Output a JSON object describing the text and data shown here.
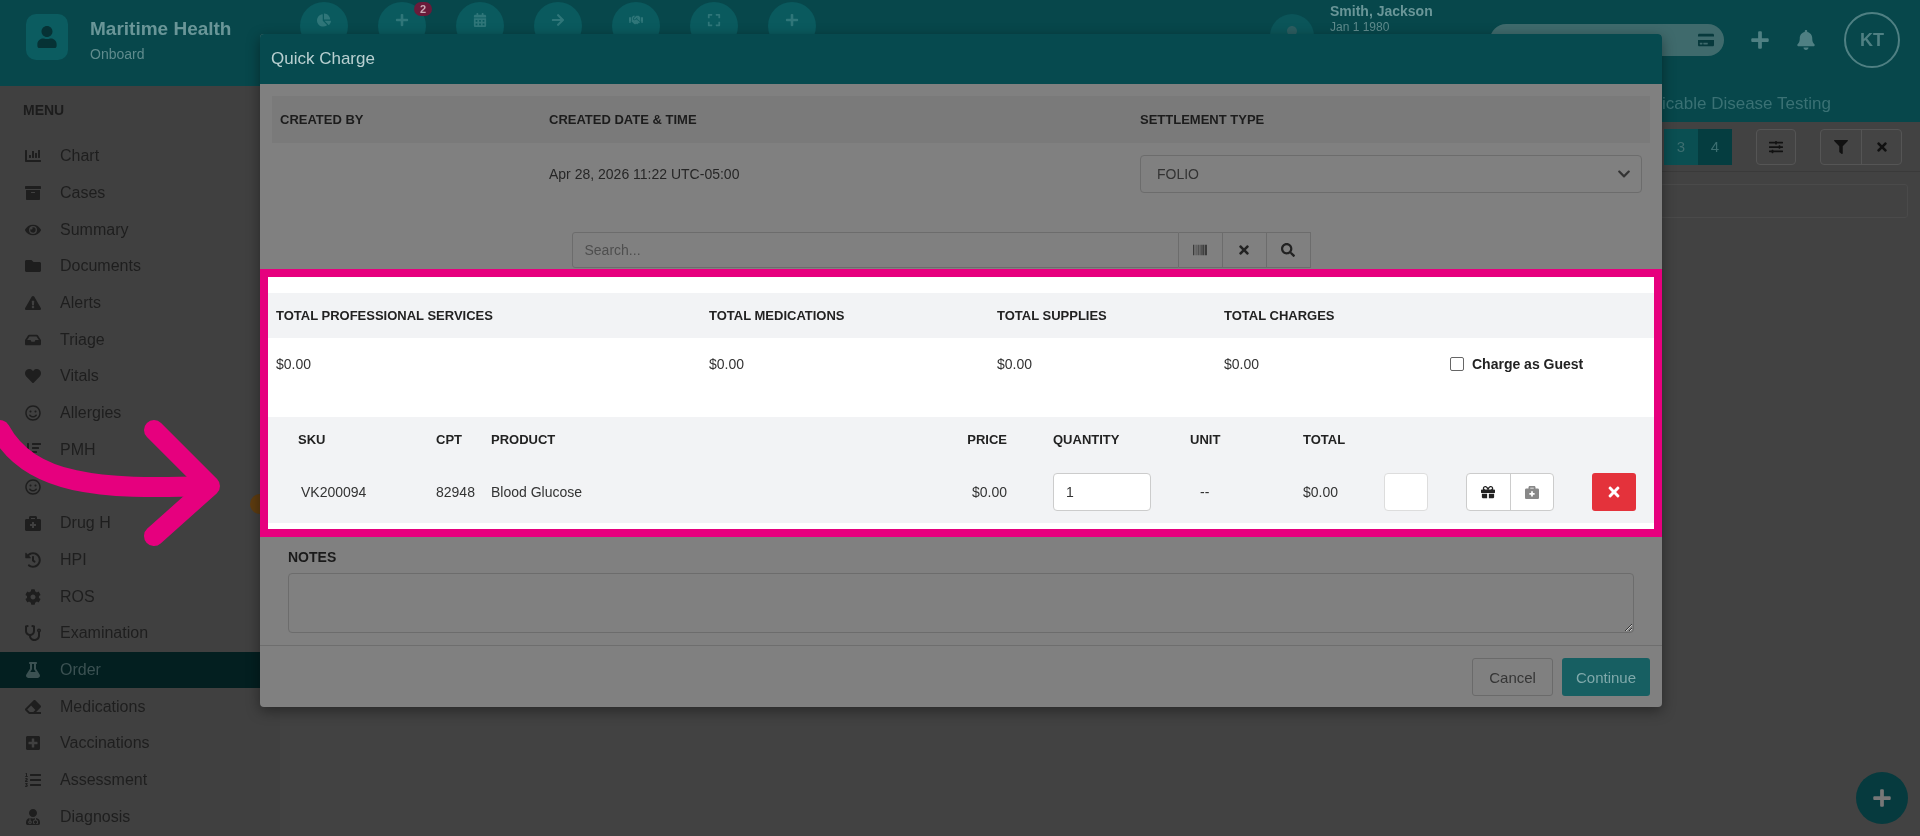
{
  "app": {
    "name": "Maritime Health",
    "subtitle": "Onboard"
  },
  "nav_buttons": [
    {
      "kind": "chart"
    },
    {
      "kind": "add",
      "badge": "2"
    },
    {
      "kind": "calendar"
    },
    {
      "kind": "arrow"
    },
    {
      "kind": "handshake"
    },
    {
      "kind": "expand"
    },
    {
      "kind": "plus"
    }
  ],
  "patient": {
    "name": "Smith, Jackson",
    "dob": "Jan 1 1980"
  },
  "user": {
    "initials": "KT"
  },
  "sidebar": {
    "heading": "MENU",
    "items": [
      {
        "label": "Chart",
        "kind": "chart",
        "selected": false
      },
      {
        "label": "Cases",
        "kind": "archive",
        "selected": false
      },
      {
        "label": "Summary",
        "kind": "eye",
        "selected": false
      },
      {
        "label": "Documents",
        "kind": "folder",
        "selected": false
      },
      {
        "label": "Alerts",
        "kind": "warning",
        "selected": false
      },
      {
        "label": "Triage",
        "kind": "inbox",
        "selected": false
      },
      {
        "label": "Vitals",
        "kind": "heart",
        "selected": false
      },
      {
        "label": "Allergies",
        "kind": "smile",
        "selected": false
      },
      {
        "label": "PMH",
        "kind": "sort",
        "selected": false
      },
      {
        "kind": "smile",
        "selected": false
      },
      {
        "label": "Drug H",
        "kind": "medkit",
        "selected": false
      },
      {
        "label": "HPI",
        "kind": "history",
        "selected": false
      },
      {
        "label": "ROS",
        "kind": "gear",
        "selected": false
      },
      {
        "label": "Examination",
        "kind": "stethoscope",
        "selected": false
      },
      {
        "label": "Order",
        "kind": "flask",
        "selected": true
      },
      {
        "label": "Medications",
        "kind": "eraser",
        "selected": false
      },
      {
        "label": "Vaccinations",
        "kind": "plus",
        "selected": false
      },
      {
        "label": "Assessment",
        "kind": "list",
        "selected": false
      },
      {
        "label": "Diagnosis",
        "kind": "doctor",
        "selected": false
      }
    ]
  },
  "context_bar": {
    "title": "icable Disease Testing"
  },
  "pagination": [
    {
      "label": "3",
      "selected": false
    },
    {
      "label": "4",
      "selected": true
    }
  ],
  "modal": {
    "title": "Quick Charge",
    "info": {
      "columns": [
        "CREATED BY",
        "CREATED DATE & TIME",
        "SETTLEMENT TYPE"
      ],
      "created_at": "Apr 28, 2026 11:22 UTC-05:00",
      "settlement_type": "FOLIO"
    },
    "search": {
      "placeholder": "Search..."
    },
    "totals": {
      "columns": [
        "TOTAL PROFESSIONAL SERVICES",
        "TOTAL MEDICATIONS",
        "TOTAL SUPPLIES",
        "TOTAL CHARGES"
      ],
      "values": [
        "$0.00",
        "$0.00",
        "$0.00",
        "$0.00"
      ]
    },
    "charge_as_guest": {
      "label": "Charge as Guest",
      "checked": false
    },
    "items": {
      "columns": [
        "SKU",
        "CPT",
        "PRODUCT",
        "PRICE",
        "QUANTITY",
        "UNIT",
        "TOTAL"
      ],
      "rows": [
        {
          "sku": "VK200094",
          "cpt": "82948",
          "product": "Blood Glucose",
          "price": "$0.00",
          "quantity": "1",
          "unit": "--",
          "total": "$0.00"
        }
      ]
    },
    "notes": {
      "label": "NOTES"
    },
    "buttons": {
      "cancel": "Cancel",
      "continue": "Continue"
    }
  }
}
